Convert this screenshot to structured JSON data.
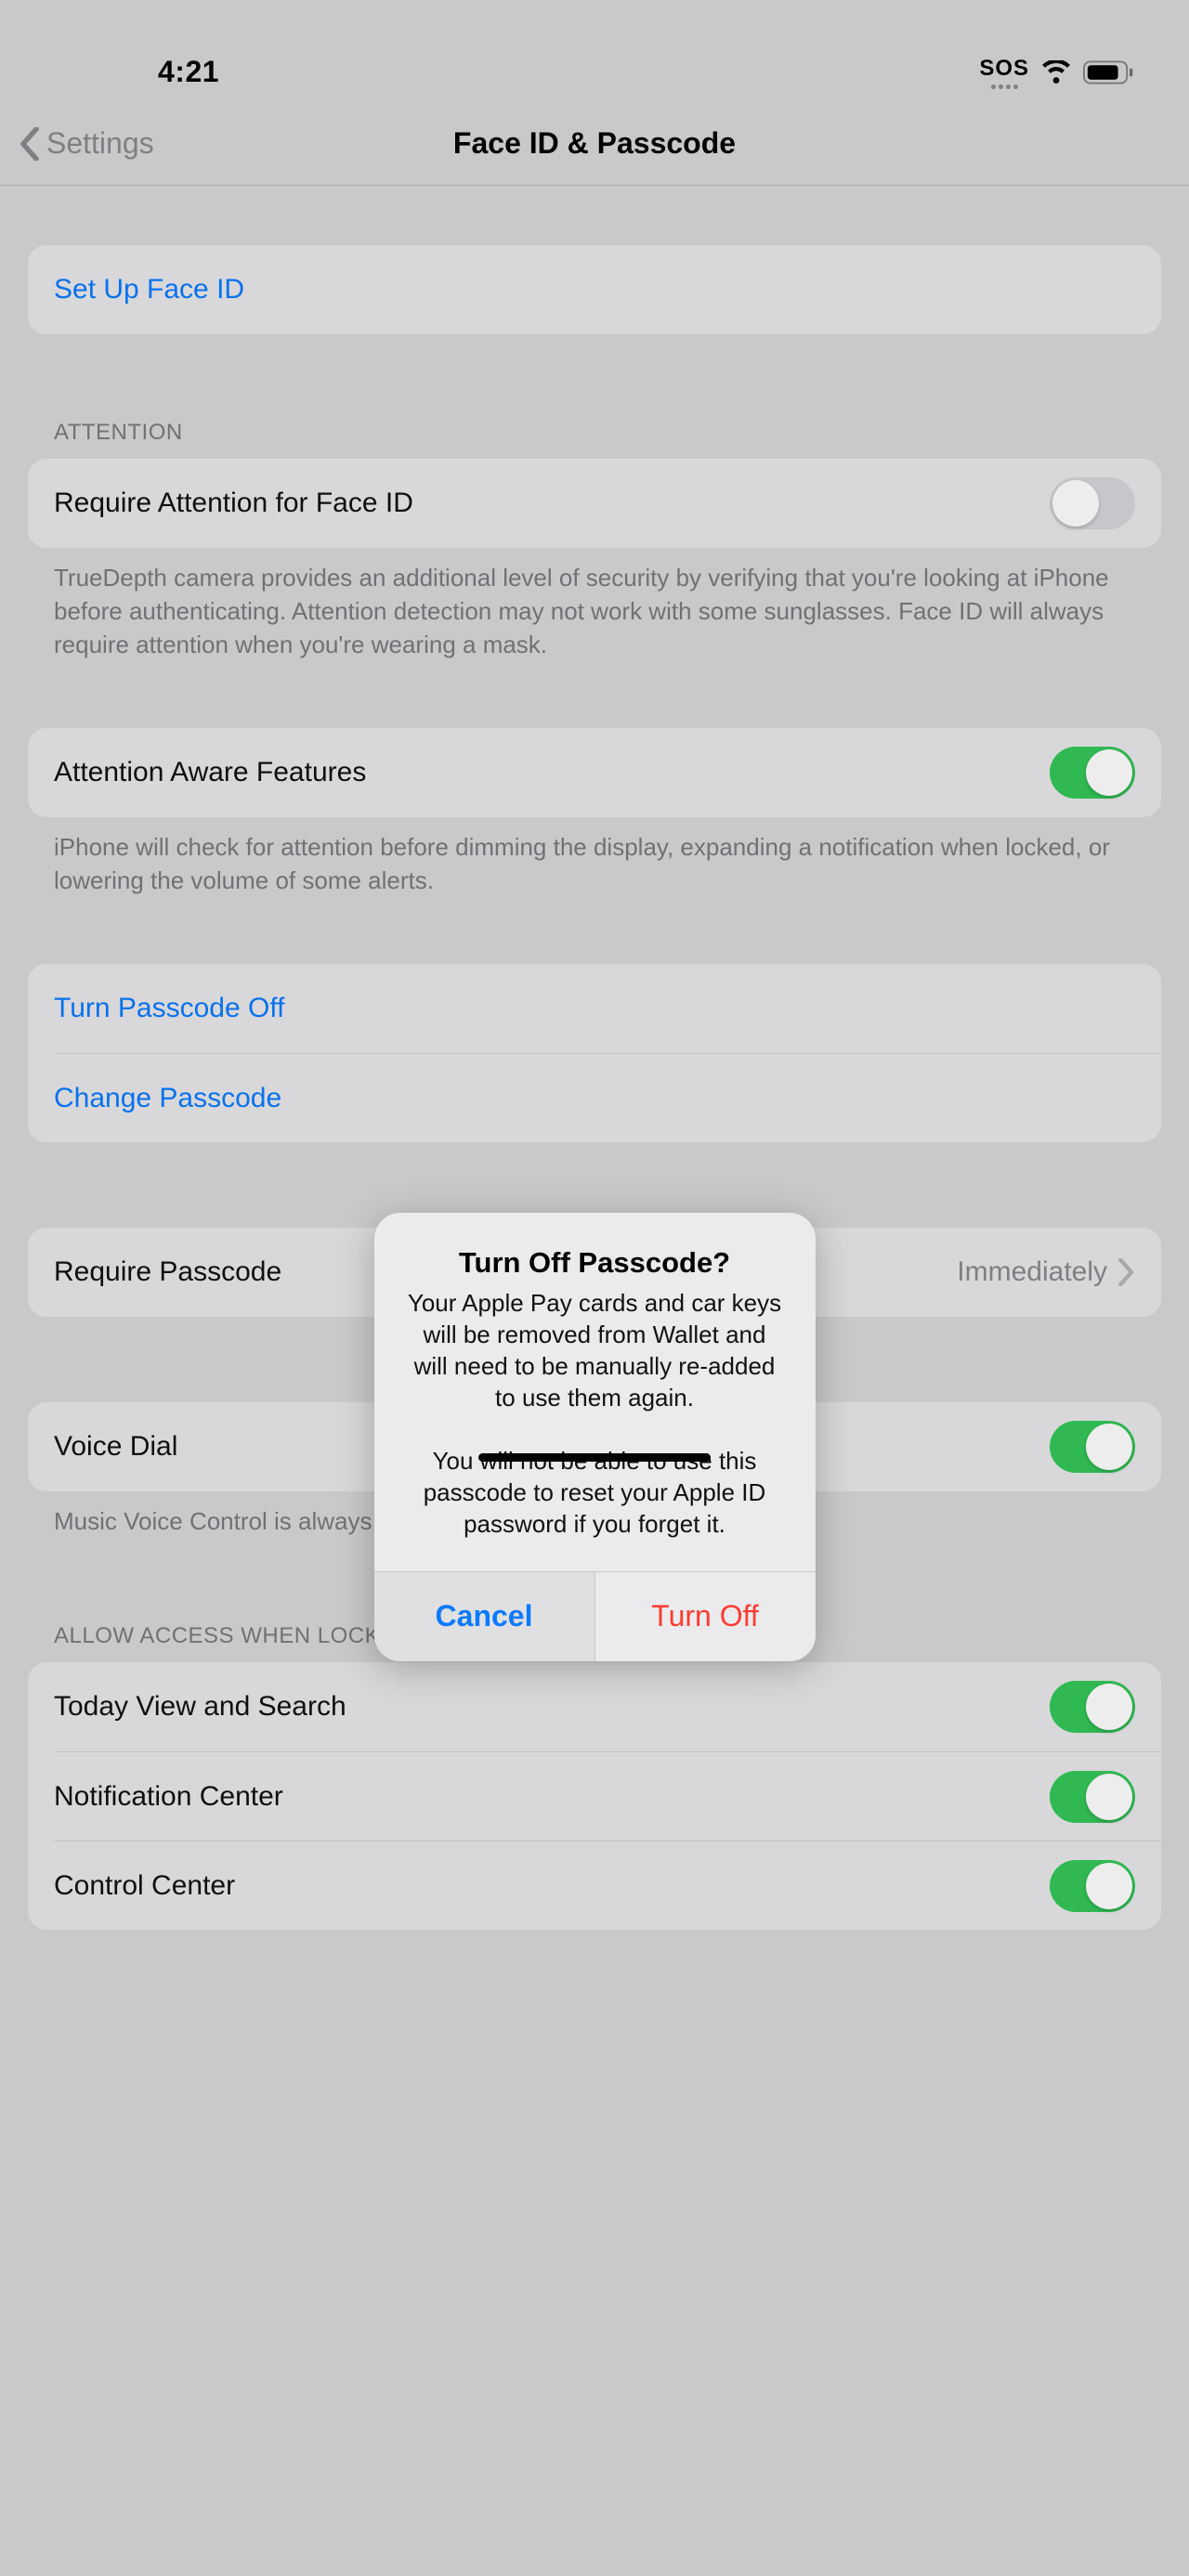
{
  "status": {
    "time": "4:21",
    "sos": "SOS"
  },
  "nav": {
    "back": "Settings",
    "title": "Face ID & Passcode"
  },
  "group_setup": {
    "label": "Set Up Face ID"
  },
  "group_attention": {
    "header": "ATTENTION",
    "row1": {
      "label": "Require Attention for Face ID",
      "on": false
    },
    "footer": "TrueDepth camera provides an additional level of security by verifying that you're looking at iPhone before authenticating. Attention detection may not work with some sunglasses. Face ID will always require attention when you're wearing a mask."
  },
  "group_aware": {
    "row": {
      "label": "Attention Aware Features",
      "on": true
    },
    "footer": "iPhone will check for attention before dimming the display, expanding a notification when locked, or lowering the volume of some alerts."
  },
  "group_passcode_actions": {
    "turn_off": "Turn Passcode Off",
    "change": "Change Passcode"
  },
  "group_require": {
    "label": "Require Passcode",
    "value": "Immediately"
  },
  "group_voice": {
    "label": "Voice Dial",
    "on": true,
    "footer": "Music Voice Control is always enabled."
  },
  "group_locked": {
    "header": "ALLOW ACCESS WHEN LOCKED:",
    "items": [
      {
        "label": "Today View and Search",
        "on": true
      },
      {
        "label": "Notification Center",
        "on": true
      },
      {
        "label": "Control Center",
        "on": true
      }
    ]
  },
  "alert": {
    "title": "Turn Off Passcode?",
    "message_p1": "Your Apple Pay cards and car keys will be removed from Wallet and will need to be manually re-added to use them again.",
    "message_p2": "You will not be able to use this passcode to reset your Apple ID password if you forget it.",
    "cancel": "Cancel",
    "confirm": "Turn Off"
  }
}
